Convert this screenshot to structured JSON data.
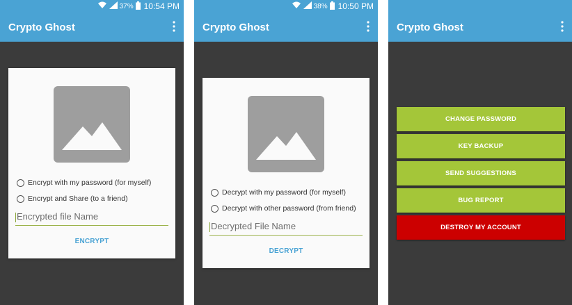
{
  "colors": {
    "appbar": "#4aa3d4",
    "accent_green": "#a4c639",
    "danger_red": "#cc0000",
    "background": "#3b3b3b"
  },
  "screens": [
    {
      "status": {
        "battery": "37%",
        "time": "10:54 PM"
      },
      "app_title": "Crypto Ghost",
      "options": [
        "Encrypt with my password (for myself)",
        "Encrypt and Share (to a friend)"
      ],
      "field_placeholder": "Encrypted file Name",
      "action_label": "ENCRYPT"
    },
    {
      "status": {
        "battery": "38%",
        "time": "10:50 PM"
      },
      "app_title": "Crypto Ghost",
      "options": [
        "Decrypt with my password (for myself)",
        "Decrypt with other password (from friend)"
      ],
      "field_placeholder": "Decrypted File Name",
      "action_label": "DECRYPT"
    },
    {
      "status": {
        "battery": "",
        "time": ""
      },
      "app_title": "Crypto Ghost",
      "buttons": [
        "CHANGE PASSWORD",
        "KEY BACKUP",
        "SEND SUGGESTIONS",
        "BUG REPORT",
        "DESTROY MY ACCOUNT"
      ]
    }
  ]
}
